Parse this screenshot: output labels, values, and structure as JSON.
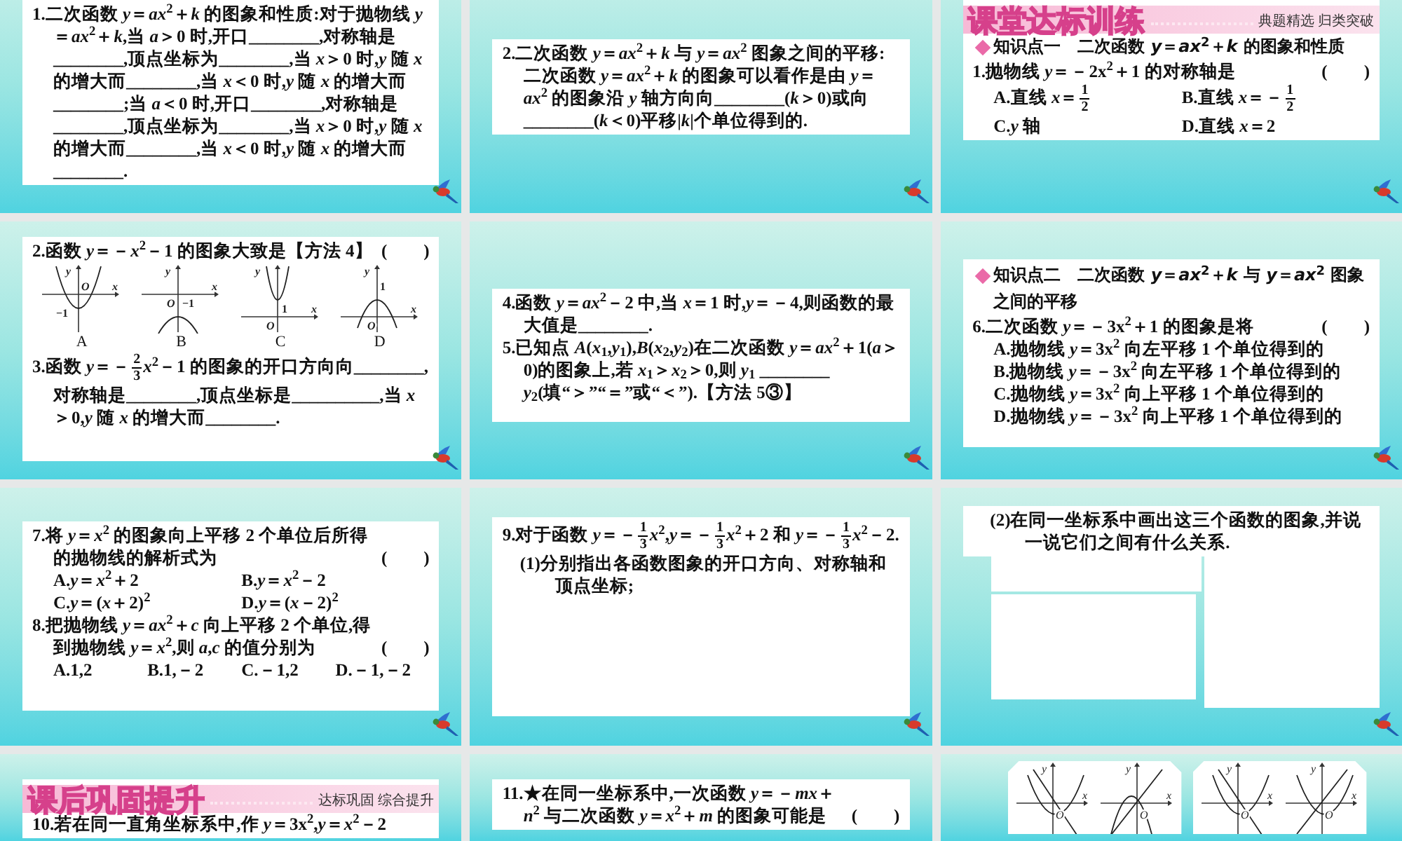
{
  "slides": [
    {
      "blocks": [
        {
          "kind": "text",
          "text": "1.二次函数 *y*＝*ax*$^{2}$＋*k* 的图象和性质:对于抛物线 *y*＝*ax*$^{2}$＋*k*,当 *a*＞0 时,开口________,对称轴是________,顶点坐标为________,当 *x*＞0 时,*y* 随 *x* 的增大而________,当 *x*＜0 时,*y* 随 *x* 的增大而________;当 *a*＜0 时,开口________,对称轴是________,顶点坐标为________,当 *x*＞0 时,*y* 随 *x* 的增大而________,当 *x*＜0 时,*y* 随 *x* 的增大而________."
        }
      ]
    },
    {
      "blocks": [
        {
          "kind": "text",
          "text": "2.二次函数 *y*＝*ax*$^{2}$＋*k* 与 *y*＝*ax*$^{2}$ 图象之间的平移:二次函数 *y*＝*ax*$^{2}$＋*k* 的图象可以看作是由 *y*＝*ax*$^{2}$ 的图象沿 *y* 轴方向向________(*k*＞0)或向________(*k*＜0)平移|*k*|个单位得到的."
        }
      ]
    },
    {
      "blocks": [
        {
          "kind": "banner",
          "title": "课堂达标训练",
          "subtitle": "典题精选 归类突破"
        },
        {
          "kind": "section",
          "text": "知识点一　二次函数 *y*＝*ax*$^{2}$＋*k* 的图象和性质"
        },
        {
          "kind": "text",
          "text": "1.抛物线 *y*＝－2x$^{2}$＋1 的对称轴是",
          "bracket": "(　　)"
        },
        {
          "kind": "options",
          "items": [
            [
              "A.直线 *x*＝",
              {
                "num": "1",
                "den": "2"
              }
            ],
            [
              "B.直线 *x*＝－",
              {
                "num": "1",
                "den": "2"
              }
            ],
            "C.*y* 轴",
            "D.直线 *x*＝2"
          ]
        }
      ]
    },
    {
      "blocks": [
        {
          "kind": "text",
          "text": "2.函数 *y*＝－*x*$^{2}$－1 的图象大致是【方法 4】",
          "bracket": "(　　)"
        },
        {
          "kind": "graphs",
          "items": [
            {
              "caption": "A",
              "opens_up": true,
              "vertex_above": false,
              "tick": "−1",
              "y": "y",
              "x": "x",
              "origin": "O"
            },
            {
              "caption": "B",
              "opens_up": false,
              "vertex_above": false,
              "tick": "−1",
              "y": "y",
              "x": "x",
              "origin": "O"
            },
            {
              "caption": "C",
              "opens_up": true,
              "vertex_above": true,
              "tick": "1",
              "y": "y",
              "x": "x",
              "origin": "O"
            },
            {
              "caption": "D",
              "opens_up": false,
              "vertex_above": true,
              "tick": "1",
              "y": "y",
              "x": "x",
              "origin": "O"
            }
          ]
        },
        {
          "kind": "text",
          "parts": [
            "3.函数 *y*＝－",
            {
              "num": "2",
              "den": "3"
            },
            "*x*$^{2}$－1 的图象的开口方向向________,对称轴是________,顶点坐标是__________,当 *x*＞0,*y* 随 *x* 的增大而________."
          ]
        }
      ]
    },
    {
      "blocks": [
        {
          "kind": "text",
          "text": "4.函数 *y*＝*ax*$^{2}$－2 中,当 *x*＝1 时,*y*＝－4,则函数的最大值是________."
        },
        {
          "kind": "text",
          "text": "5.已知点 *A*(*x*$_{1}$,*y*$_{1}$),*B*(*x*$_{2}$,*y*$_{2}$)在二次函数 *y*＝*ax*$^{2}$＋1(*a*＞0)的图象上,若 *x*$_{1}$＞*x*$_{2}$＞0,则 *y*$_{1}$ ________ *y*$_{2}$(填“＞”“＝”或“＜”).【方法 5③】"
        }
      ]
    },
    {
      "blocks": [
        {
          "kind": "section",
          "text": "知识点二　二次函数 *y*＝*ax*$^{2}$＋*k* 与 *y*＝*ax*$^{2}$ 图象之间的平移"
        },
        {
          "kind": "text",
          "text": "6.二次函数 *y*＝－3x$^{2}$＋1 的图象是将",
          "bracket": "(　　)"
        },
        {
          "kind": "options",
          "items": [
            "A.抛物线 *y*＝3x$^{2}$ 向左平移 1 个单位得到的",
            "B.抛物线 *y*＝－3x$^{2}$ 向左平移 1 个单位得到的",
            "C.抛物线 *y*＝3x$^{2}$ 向上平移 1 个单位得到的",
            "D.抛物线 *y*＝－3x$^{2}$ 向上平移 1 个单位得到的"
          ]
        }
      ]
    },
    {
      "blocks": [
        {
          "kind": "text",
          "text": "7.将 *y*＝*x*$^{2}$ 的图象向上平移 2 个单位后所得的抛物线的解析式为",
          "bracket": "(　　)"
        },
        {
          "kind": "options",
          "items": [
            "A.*y*＝*x*$^{2}$＋2",
            "B.*y*＝*x*$^{2}$－2",
            "C.*y*＝(*x*＋2)$^{2}$",
            "D.*y*＝(*x*－2)$^{2}$"
          ]
        },
        {
          "kind": "text",
          "text": "8.把抛物线 *y*＝*ax*$^{2}$＋*c* 向上平移 2 个单位,得到抛物线 *y*＝*x*$^{2}$,则 *a*,*c* 的值分别为",
          "bracket": "(　　)"
        },
        {
          "kind": "options",
          "items": [
            "A.1,2",
            "B.1,－2",
            "C.－1,2",
            "D.－1,－2"
          ]
        }
      ]
    },
    {
      "blocks": [
        {
          "kind": "text",
          "parts": [
            "9.对于函数 *y*＝－",
            {
              "num": "1",
              "den": "3"
            },
            "*x*$^{2}$,*y*＝－",
            {
              "num": "1",
              "den": "3"
            },
            "*x*$^{2}$＋2 和 *y*＝－",
            {
              "num": "1",
              "den": "3"
            },
            "*x*$^{2}$－2."
          ]
        },
        {
          "kind": "subtext",
          "text": "(1)分别指出各函数图象的开口方向、对称轴和顶点坐标;"
        }
      ]
    },
    {
      "blocks": [
        {
          "kind": "subtext",
          "text": "(2)在同一坐标系中画出这三个函数的图象,并说一说它们之间有什么关系."
        },
        {
          "kind": "blanks"
        }
      ]
    },
    {
      "blocks": [
        {
          "kind": "banner",
          "title": "课后巩固提升",
          "subtitle": "达标巩固 综合提升"
        },
        {
          "kind": "text",
          "text": "10.若在同一直角坐标系中,作 *y*＝3x$^{2}$,*y*＝*x*$^{2}$－2"
        }
      ]
    },
    {
      "blocks": [
        {
          "kind": "text",
          "text": "11.★在同一坐标系中,一次函数 *y*＝－*mx*＋*n*$^{2}$ 与二次函数 *y*＝*x*$^{2}$＋*m* 的图象可能是",
          "bracket": "(　　)"
        }
      ]
    },
    {
      "blocks": [
        {
          "kind": "cards",
          "items": [
            {
              "opens_up": true,
              "line_rising": false,
              "y": "y",
              "x": "x",
              "origin": "O"
            },
            {
              "opens_up": false,
              "line_rising": true,
              "y": "y",
              "x": "x",
              "origin": "O"
            },
            {
              "opens_up": true,
              "line_rising": false,
              "y": "y",
              "x": "x",
              "origin": "O"
            },
            {
              "opens_up": true,
              "line_rising": true,
              "y": "y",
              "x": "x",
              "origin": "O"
            }
          ]
        }
      ]
    }
  ]
}
